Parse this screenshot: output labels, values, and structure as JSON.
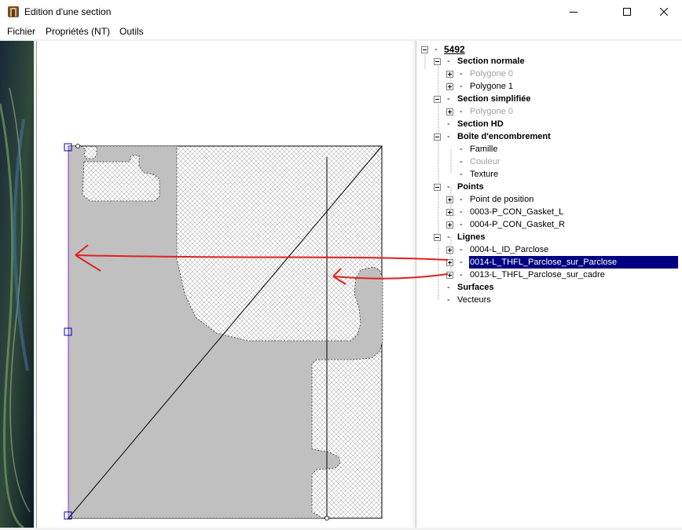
{
  "window": {
    "title": "Edition d'une section"
  },
  "menu": [
    "Fichier",
    "Propriétés (NT)",
    "Outils"
  ],
  "tree": {
    "root": "5492",
    "items": [
      {
        "label": "Section normale",
        "bold": true,
        "level": 1,
        "expander": "minus"
      },
      {
        "label": "Polygone 0",
        "level": 2,
        "expander": "plus",
        "disabled": true
      },
      {
        "label": "Polygone 1",
        "level": 2,
        "expander": "plus"
      },
      {
        "label": "Section simplifiée",
        "bold": true,
        "level": 1,
        "expander": "minus"
      },
      {
        "label": "Polygone 0",
        "level": 2,
        "expander": "plus",
        "disabled": true
      },
      {
        "label": "Section HD",
        "bold": true,
        "level": 1,
        "expander": "none"
      },
      {
        "label": "Boîte d'encombrement",
        "bold": true,
        "level": 1,
        "expander": "minus"
      },
      {
        "label": "Famille",
        "level": 2,
        "expander": "none"
      },
      {
        "label": "Couleur",
        "level": 2,
        "expander": "none",
        "disabled": true
      },
      {
        "label": "Texture",
        "level": 2,
        "expander": "none"
      },
      {
        "label": "Points",
        "bold": true,
        "level": 1,
        "expander": "minus"
      },
      {
        "label": "Point de position",
        "level": 2,
        "expander": "plus"
      },
      {
        "label": "0003-P_CON_Gasket_L",
        "level": 2,
        "expander": "plus"
      },
      {
        "label": "0004-P_CON_Gasket_R",
        "level": 2,
        "expander": "plus"
      },
      {
        "label": "Lignes",
        "bold": true,
        "level": 1,
        "expander": "minus"
      },
      {
        "label": "0004-L_ID_Parclose",
        "level": 2,
        "expander": "plus"
      },
      {
        "label": "0014-L_THFL_Parclose_sur_Parclose",
        "level": 2,
        "expander": "plus",
        "selected": true
      },
      {
        "label": "0013-L_THFL_Parclose_sur_cadre",
        "level": 2,
        "expander": "plus"
      },
      {
        "label": "Surfaces",
        "bold": true,
        "level": 1,
        "expander": "none"
      },
      {
        "label": "Vecteurs",
        "level": 1,
        "expander": "none"
      }
    ]
  },
  "colors": {
    "selection": "#000080",
    "section_fill": "#c0c0c0",
    "annotation_arrow": "#e02020",
    "guide_line": "#9a30c0"
  }
}
